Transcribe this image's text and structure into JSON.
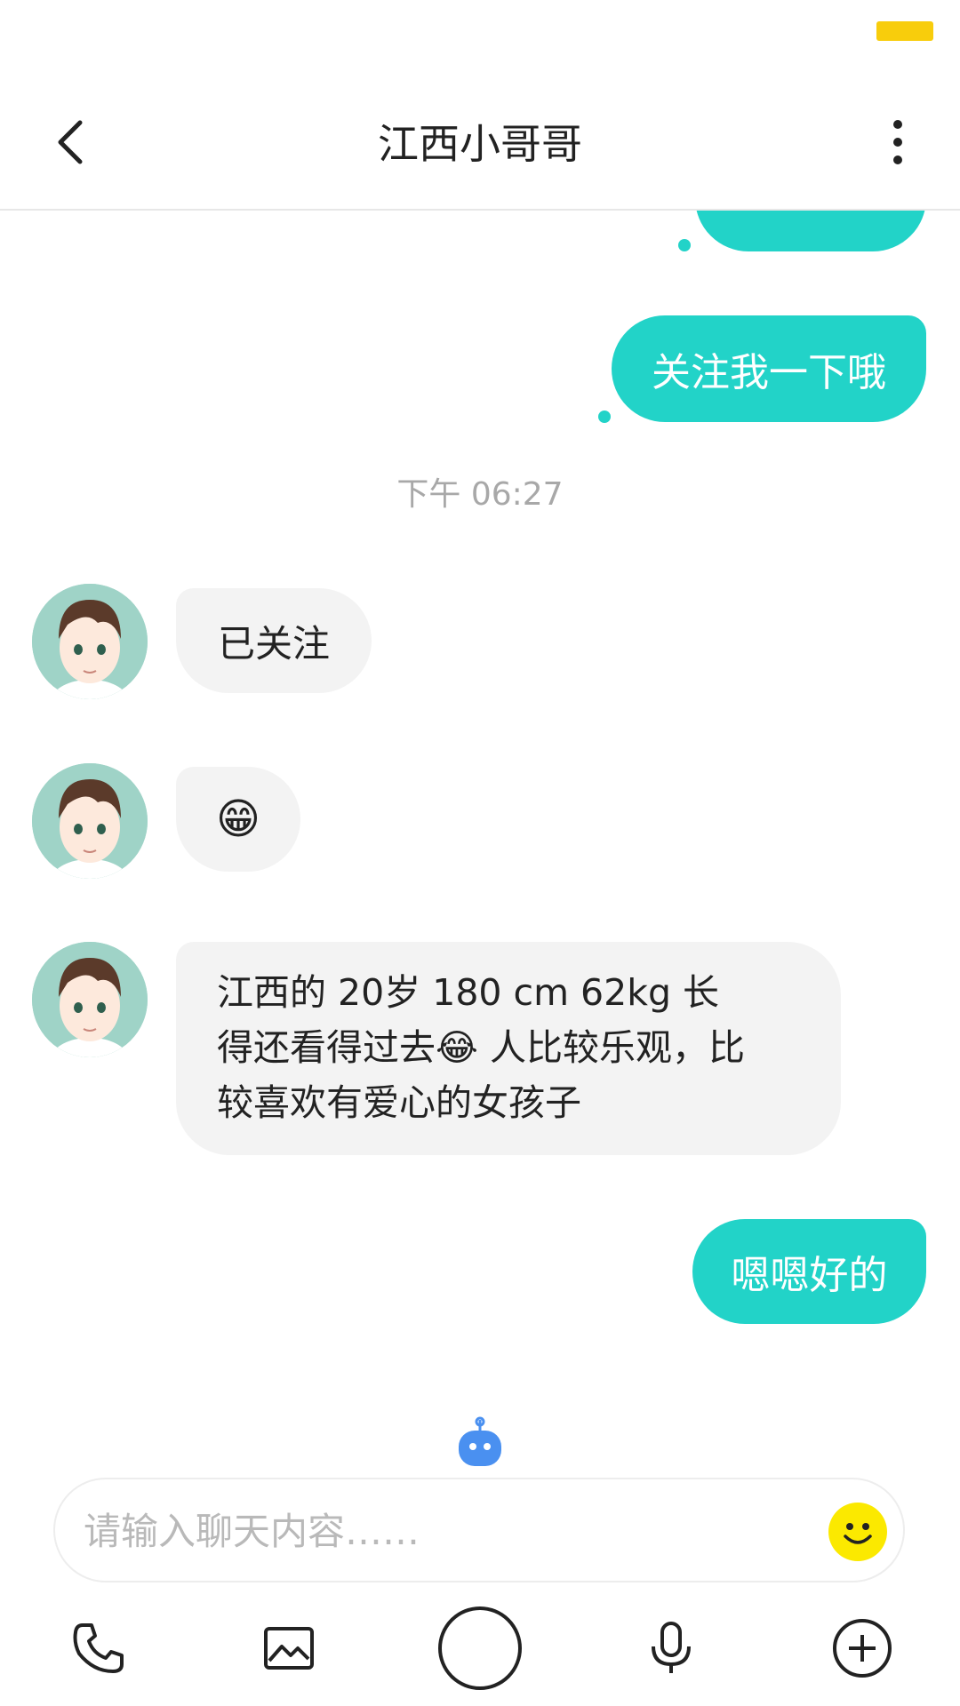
{
  "header": {
    "title": "江西小哥哥"
  },
  "messages": {
    "out_1": "关注我一下哦",
    "timestamp": "下午 06:27",
    "in_1": "已关注",
    "in_2_emoji": "😁",
    "in_3_line1_prefix": "江西的  20岁 180 cm  62kg 长",
    "in_3_line2_prefix": "得还看得过去",
    "in_3_line2_emoji": "😂",
    "in_3_line2_suffix": " 人比较乐观，比",
    "in_3_line3": "较喜欢有爱心的女孩子",
    "out_2": "嗯嗯好的"
  },
  "composer": {
    "placeholder": "请输入聊天内容……"
  },
  "colors": {
    "accent": "#22d3c8",
    "incoming_bubble": "#f3f3f3",
    "battery": "#f8cd0c",
    "emoji_button": "#fbe900",
    "robot": "#4a90f0"
  },
  "icons": [
    "back-icon",
    "more-icon",
    "robot-icon",
    "emoji-icon",
    "phone-icon",
    "image-icon",
    "camera-shutter-icon",
    "microphone-icon",
    "plus-circle-icon"
  ]
}
